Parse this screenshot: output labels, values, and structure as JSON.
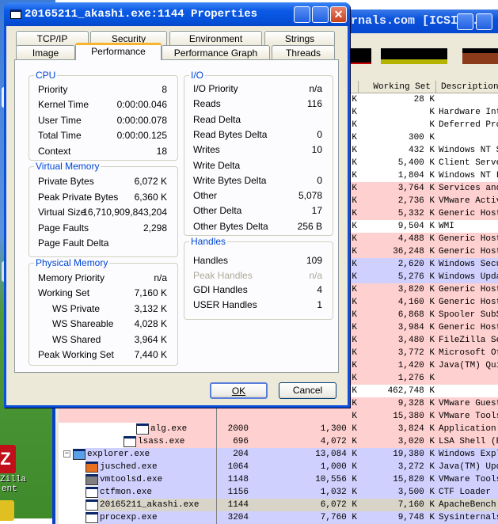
{
  "background_window": {
    "title_fragment": "rnals.com [ICSI...",
    "columns": {
      "working_set": "Working Set",
      "description": "Description"
    },
    "graph_colors": {
      "cpu": "#000000",
      "memory": "#c8c800",
      "io": "#8b3a1a"
    },
    "rows": [
      {
        "name": "",
        "pid": "",
        "private": "K",
        "ws": "28 K",
        "desc": "",
        "bg": "#ffffff",
        "depth": 0
      },
      {
        "name": "",
        "pid": "",
        "private": "K",
        "ws": "K",
        "desc": "Hardware Inte",
        "bg": "#ffffff",
        "depth": 0
      },
      {
        "name": "",
        "pid": "",
        "private": "K",
        "ws": "K",
        "desc": "Deferred Proc",
        "bg": "#ffffff",
        "depth": 0
      },
      {
        "name": "",
        "pid": "",
        "private": "K",
        "ws": "300 K",
        "desc": "",
        "bg": "#ffffff",
        "depth": 0
      },
      {
        "name": "",
        "pid": "",
        "private": "K",
        "ws": "432 K",
        "desc": "Windows NT Se",
        "bg": "#ffffff",
        "depth": 0
      },
      {
        "name": "",
        "pid": "",
        "private": "K",
        "ws": "5,400 K",
        "desc": "Client Server",
        "bg": "#ffffff",
        "depth": 0
      },
      {
        "name": "",
        "pid": "",
        "private": "K",
        "ws": "1,804 K",
        "desc": "Windows NT Lo",
        "bg": "#ffffff",
        "depth": 0
      },
      {
        "name": "",
        "pid": "",
        "private": "K",
        "ws": "3,764 K",
        "desc": "Services and",
        "bg": "#ffd0d0",
        "depth": 0
      },
      {
        "name": "",
        "pid": "",
        "private": "K",
        "ws": "2,736 K",
        "desc": "VMware Activa",
        "bg": "#ffd0d0",
        "depth": 0
      },
      {
        "name": "",
        "pid": "",
        "private": "K",
        "ws": "5,332 K",
        "desc": "Generic Host",
        "bg": "#ffd0d0",
        "depth": 0
      },
      {
        "name": "",
        "pid": "",
        "private": "K",
        "ws": "9,504 K",
        "desc": "WMI",
        "bg": "#ffffff",
        "depth": 0
      },
      {
        "name": "",
        "pid": "",
        "private": "K",
        "ws": "4,488 K",
        "desc": "Generic Host",
        "bg": "#ffd0d0",
        "depth": 0
      },
      {
        "name": "",
        "pid": "",
        "private": "K",
        "ws": "36,248 K",
        "desc": "Generic Host",
        "bg": "#ffd0d0",
        "depth": 0
      },
      {
        "name": "",
        "pid": "",
        "private": "K",
        "ws": "2,620 K",
        "desc": "Windows Secur",
        "bg": "#d0d0ff",
        "depth": 0
      },
      {
        "name": "",
        "pid": "",
        "private": "K",
        "ws": "5,276 K",
        "desc": "Windows Updat",
        "bg": "#d0d0ff",
        "depth": 0
      },
      {
        "name": "",
        "pid": "",
        "private": "K",
        "ws": "3,820 K",
        "desc": "Generic Host",
        "bg": "#ffd0d0",
        "depth": 0
      },
      {
        "name": "",
        "pid": "",
        "private": "K",
        "ws": "4,160 K",
        "desc": "Generic Host",
        "bg": "#ffd0d0",
        "depth": 0
      },
      {
        "name": "",
        "pid": "",
        "private": "K",
        "ws": "6,868 K",
        "desc": "Spooler SubSy",
        "bg": "#ffd0d0",
        "depth": 0
      },
      {
        "name": "",
        "pid": "",
        "private": "K",
        "ws": "3,984 K",
        "desc": "Generic Host",
        "bg": "#ffd0d0",
        "depth": 0
      },
      {
        "name": "",
        "pid": "",
        "private": "K",
        "ws": "3,480 K",
        "desc": "FileZilla Ser",
        "bg": "#ffd0d0",
        "depth": 0
      },
      {
        "name": "",
        "pid": "",
        "private": "K",
        "ws": "3,772 K",
        "desc": "Microsoft Off",
        "bg": "#ffd0d0",
        "depth": 0
      },
      {
        "name": "",
        "pid": "",
        "private": "K",
        "ws": "1,420 K",
        "desc": "Java(TM) Quic",
        "bg": "#ffd0d0",
        "depth": 0
      },
      {
        "name": "",
        "pid": "",
        "private": "K",
        "ws": "1,276 K",
        "desc": "",
        "bg": "#ffd0d0",
        "depth": 0
      },
      {
        "name": "",
        "pid": "",
        "private": "K",
        "ws": "462,748 K",
        "desc": "",
        "bg": "#ffffff",
        "depth": 0
      },
      {
        "name": "",
        "pid": "",
        "private": "K",
        "ws": "9,328 K",
        "desc": "VMware Guest",
        "bg": "#ffd0d0",
        "depth": 0
      },
      {
        "name": "",
        "pid": "",
        "private": "K",
        "ws": "15,380 K",
        "desc": "VMware Tools",
        "bg": "#ffd0d0",
        "depth": 0
      },
      {
        "name": "alg.exe",
        "pid": "2000",
        "private": "1,300 K",
        "ws": "3,824 K",
        "desc": "Application L",
        "bg": "#ffd0d0",
        "depth": 5,
        "icon": "window-icon"
      },
      {
        "name": "lsass.exe",
        "pid": "696",
        "private": "4,072 K",
        "ws": "3,020 K",
        "desc": "LSA Shell (Ex",
        "bg": "#ffd0d0",
        "depth": 4,
        "icon": "window-icon"
      },
      {
        "name": "explorer.exe",
        "pid": "204",
        "private": "13,084 K",
        "ws": "19,380 K",
        "desc": "Windows Explo",
        "bg": "#d0d0ff",
        "depth": 0,
        "icon": "explorer-icon",
        "expander": "−"
      },
      {
        "name": "jusched.exe",
        "pid": "1064",
        "private": "1,000 K",
        "ws": "3,272 K",
        "desc": "Java(TM) Upda",
        "bg": "#d0d0ff",
        "depth": 1,
        "icon": "java-icon"
      },
      {
        "name": "vmtoolsd.exe",
        "pid": "1148",
        "private": "10,556 K",
        "ws": "15,820 K",
        "desc": "VMware Tools",
        "bg": "#d0d0ff",
        "depth": 1,
        "icon": "vmware-icon"
      },
      {
        "name": "ctfmon.exe",
        "pid": "1156",
        "private": "1,032 K",
        "ws": "3,500 K",
        "desc": "CTF Loader",
        "bg": "#d0d0ff",
        "depth": 1,
        "icon": "ctfmon-icon"
      },
      {
        "name": "20165211_akashi.exe",
        "pid": "1144",
        "private": "6,072 K",
        "ws": "7,160 K",
        "desc": "ApacheBench c",
        "bg": "#d8d4c8",
        "depth": 1,
        "icon": "window-icon"
      },
      {
        "name": "procexp.exe",
        "pid": "3204",
        "private": "7,760 K",
        "ws": "9,748 K",
        "desc": "Sysinternals",
        "bg": "#d0d0ff",
        "depth": 1,
        "icon": "procexp-icon"
      }
    ]
  },
  "desktop": {
    "icon_label_1": "Zilla",
    "icon_label_2": "ent"
  },
  "dialog": {
    "title": "20165211_akashi.exe:1144 Properties",
    "tabs_row1": [
      "TCP/IP",
      "Security",
      "Environment",
      "Strings"
    ],
    "tabs_row2": [
      "Image",
      "Performance",
      "Performance Graph",
      "Threads"
    ],
    "selected_tab": "Performance",
    "groups": {
      "cpu": {
        "title": "CPU",
        "items": [
          {
            "label": "Priority",
            "value": "8"
          },
          {
            "label": "Kernel Time",
            "value": "0:00:00.046"
          },
          {
            "label": "User Time",
            "value": "0:00:00.078"
          },
          {
            "label": "Total Time",
            "value": "0:00:00.125"
          },
          {
            "label": "Context",
            "value": "18"
          }
        ]
      },
      "virtual_memory": {
        "title": "Virtual Memory",
        "items": [
          {
            "label": "Private Bytes",
            "value": "6,072 K"
          },
          {
            "label": "Peak Private Bytes",
            "value": "6,360 K"
          },
          {
            "label": "Virtual Size",
            "value": "16,710,909,843,204"
          },
          {
            "label": "Page Faults",
            "value": "2,298"
          },
          {
            "label": "Page Fault Delta",
            "value": ""
          }
        ]
      },
      "physical_memory": {
        "title": "Physical Memory",
        "items": [
          {
            "label": "Memory Priority",
            "value": "n/a"
          },
          {
            "label": "Working Set",
            "value": "7,160 K"
          },
          {
            "label": "WS Private",
            "value": "3,132 K",
            "indent": true
          },
          {
            "label": "WS Shareable",
            "value": "4,028 K",
            "indent": true
          },
          {
            "label": "WS Shared",
            "value": "3,964 K",
            "indent": true
          },
          {
            "label": "Peak Working Set",
            "value": "7,440 K"
          }
        ]
      },
      "io": {
        "title": "I/O",
        "items": [
          {
            "label": "I/O Priority",
            "value": "n/a"
          },
          {
            "label": "Reads",
            "value": "116"
          },
          {
            "label": "Read Delta",
            "value": ""
          },
          {
            "label": "Read Bytes Delta",
            "value": "0"
          },
          {
            "label": "Writes",
            "value": "10"
          },
          {
            "label": "Write Delta",
            "value": ""
          },
          {
            "label": "Write Bytes Delta",
            "value": "0"
          },
          {
            "label": "Other",
            "value": "5,078"
          },
          {
            "label": "Other Delta",
            "value": "17"
          },
          {
            "label": "Other Bytes Delta",
            "value": "256 B"
          }
        ]
      },
      "handles": {
        "title": "Handles",
        "items": [
          {
            "label": "Handles",
            "value": "109"
          },
          {
            "label": "Peak Handles",
            "value": "n/a",
            "disabled": true
          },
          {
            "label": "GDI Handles",
            "value": "4"
          },
          {
            "label": "USER Handles",
            "value": "1"
          }
        ]
      }
    },
    "ok_label": "OK",
    "cancel_label": "Cancel"
  }
}
